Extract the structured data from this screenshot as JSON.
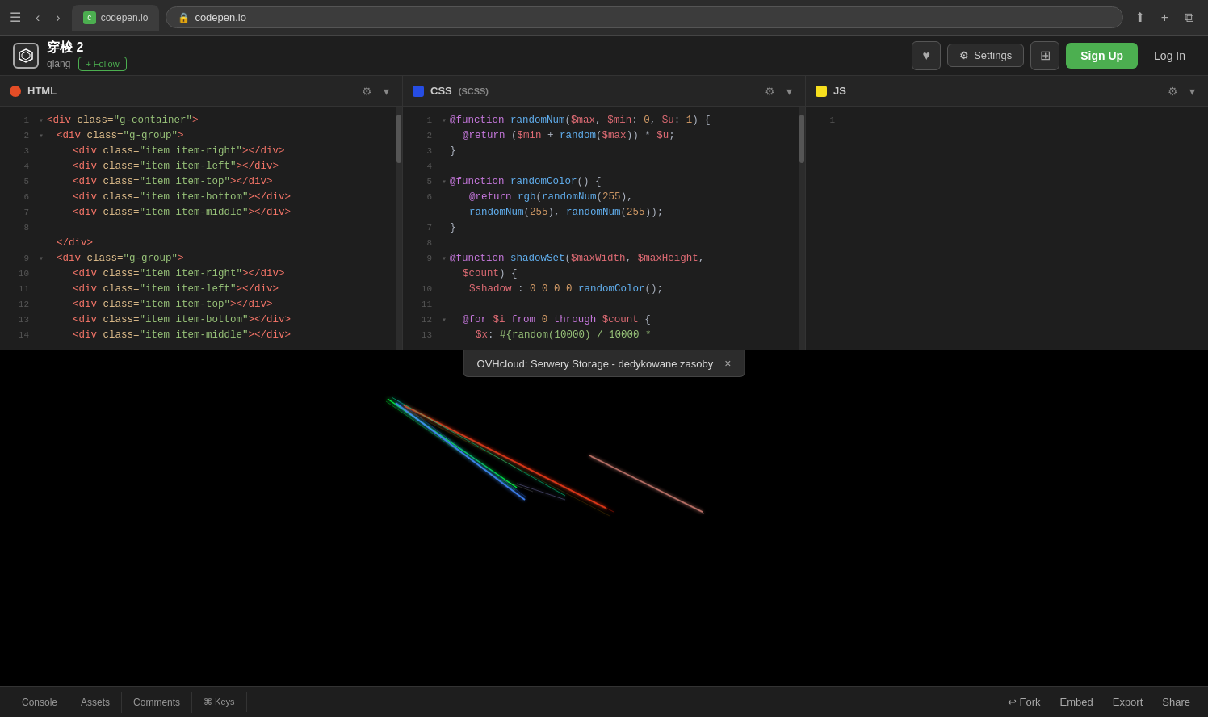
{
  "browser": {
    "url": "codepen.io",
    "tab_label": "codepen.io"
  },
  "app": {
    "logo_symbol": "⬡",
    "project_title": "穿梭 2",
    "author": "qiang",
    "follow_label": "+ Follow",
    "heart_icon": "♥",
    "settings_label": "Settings",
    "grid_icon": "⊞",
    "signup_label": "Sign Up",
    "login_label": "Log In"
  },
  "panels": {
    "html": {
      "title": "HTML",
      "settings_icon": "⚙",
      "collapse_icon": "▾",
      "lines": [
        {
          "num": "1",
          "collapse": "▾",
          "content": "<div class=\"g-container\">"
        },
        {
          "num": "2",
          "collapse": "▾",
          "content": "  <div class=\"g-group\">"
        },
        {
          "num": "3",
          "collapse": "",
          "content": "      <div class=\"item item-right\"></div>"
        },
        {
          "num": "4",
          "collapse": "",
          "content": "      <div class=\"item item-left\"></div>"
        },
        {
          "num": "5",
          "collapse": "",
          "content": "      <div class=\"item item-top\"></div>"
        },
        {
          "num": "6",
          "collapse": "",
          "content": "      <div class=\"item item-bottom\"></div>"
        },
        {
          "num": "7",
          "collapse": "",
          "content": "      <div class=\"item item-middle\"></div>"
        },
        {
          "num": "8",
          "collapse": "",
          "content": ""
        },
        {
          "num": "8",
          "collapse": "",
          "content": "  </div>"
        },
        {
          "num": "9",
          "collapse": "▾",
          "content": "  <div class=\"g-group\">"
        },
        {
          "num": "10",
          "collapse": "",
          "content": "      <div class=\"item item-right\"></div>"
        },
        {
          "num": "11",
          "collapse": "",
          "content": "      <div class=\"item item-left\"></div>"
        },
        {
          "num": "12",
          "collapse": "",
          "content": "      <div class=\"item item-top\"></div>"
        },
        {
          "num": "13",
          "collapse": "",
          "content": "      <div class=\"item item-bottom\"></div>"
        },
        {
          "num": "14",
          "collapse": "",
          "content": "      <div class=\"item item-middle\"></div>"
        }
      ]
    },
    "css": {
      "title": "CSS",
      "subtitle": "(SCSS)",
      "settings_icon": "⚙",
      "collapse_icon": "▾",
      "lines": [
        {
          "num": "1",
          "collapse": "▾",
          "content": "@function randomNum($max, $min: 0, $u: 1) {"
        },
        {
          "num": "2",
          "collapse": "",
          "content": "  @return ($min + random($max)) * $u;"
        },
        {
          "num": "3",
          "collapse": "",
          "content": "}"
        },
        {
          "num": "4",
          "collapse": "",
          "content": ""
        },
        {
          "num": "5",
          "collapse": "▾",
          "content": "@function randomColor() {"
        },
        {
          "num": "6",
          "collapse": "",
          "content": "    @return rgb(randomNum(255),"
        },
        {
          "num": "",
          "collapse": "",
          "content": "    randomNum(255), randomNum(255));"
        },
        {
          "num": "7",
          "collapse": "",
          "content": "}"
        },
        {
          "num": "8",
          "collapse": "",
          "content": ""
        },
        {
          "num": "9",
          "collapse": "▾",
          "content": "@function shadowSet($maxWidth, $maxHeight,"
        },
        {
          "num": "",
          "collapse": "",
          "content": "    $count) {"
        },
        {
          "num": "10",
          "collapse": "",
          "content": "    $shadow : 0 0 0 0 randomColor();"
        },
        {
          "num": "11",
          "collapse": "",
          "content": ""
        },
        {
          "num": "12",
          "collapse": "▾",
          "content": "    @for $i from 0 through $count {"
        },
        {
          "num": "13",
          "collapse": "",
          "content": "        $x: #{random(10000) / 10000 *"
        }
      ]
    },
    "js": {
      "title": "JS",
      "settings_icon": "⚙",
      "collapse_icon": "▾",
      "lines": [
        {
          "num": "1",
          "content": ""
        }
      ]
    }
  },
  "notification": {
    "text": "OVHcloud: Serwery Storage - dedykowane zasoby",
    "close_icon": "×"
  },
  "bottom_bar": {
    "tabs": [
      {
        "label": "Console"
      },
      {
        "label": "Assets"
      },
      {
        "label": "Comments"
      },
      {
        "label": "⌘ Keys"
      }
    ],
    "actions": [
      {
        "label": "↩ Fork"
      },
      {
        "label": "Embed"
      },
      {
        "label": "Export"
      },
      {
        "label": "Share"
      }
    ]
  }
}
